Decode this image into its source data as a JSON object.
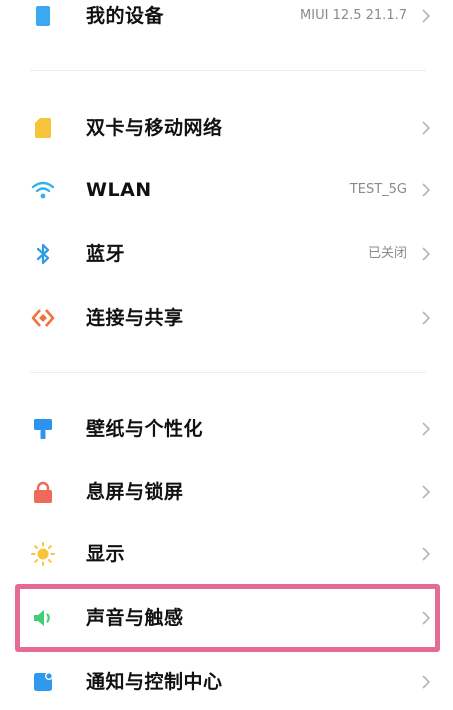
{
  "settings": {
    "my_device": {
      "label": "我的设备",
      "value": "MIUI 12.5 21.1.7",
      "icon": "device-icon"
    },
    "dual_sim": {
      "label": "双卡与移动网络",
      "icon": "sim-card-icon"
    },
    "wlan": {
      "label": "WLAN",
      "value": "TEST_5G",
      "icon": "wifi-icon"
    },
    "bluetooth": {
      "label": "蓝牙",
      "value": "已关闭",
      "icon": "bluetooth-icon"
    },
    "connection_sharing": {
      "label": "连接与共享",
      "icon": "share-icon"
    },
    "wallpaper": {
      "label": "壁纸与个性化",
      "icon": "brush-icon"
    },
    "lock_screen": {
      "label": "息屏与锁屏",
      "icon": "lock-icon"
    },
    "display": {
      "label": "显示",
      "icon": "sun-icon"
    },
    "sound": {
      "label": "声音与触感",
      "icon": "speaker-icon",
      "highlighted": true
    },
    "notifications": {
      "label": "通知与控制中心",
      "icon": "notification-icon"
    }
  },
  "colors": {
    "highlight_border": "#e56b93",
    "device_icon": "#3ba8f0",
    "sim_icon": "#f6c33a",
    "wifi_icon": "#2fb3e6",
    "bluetooth_icon": "#2f9be8",
    "share_icon": "#f0733c",
    "brush_icon": "#2d93ef",
    "lock_icon": "#ef6a5a",
    "sun_icon": "#f8c43a",
    "speaker_icon": "#3fcf77",
    "notification_icon": "#2f98ef"
  }
}
